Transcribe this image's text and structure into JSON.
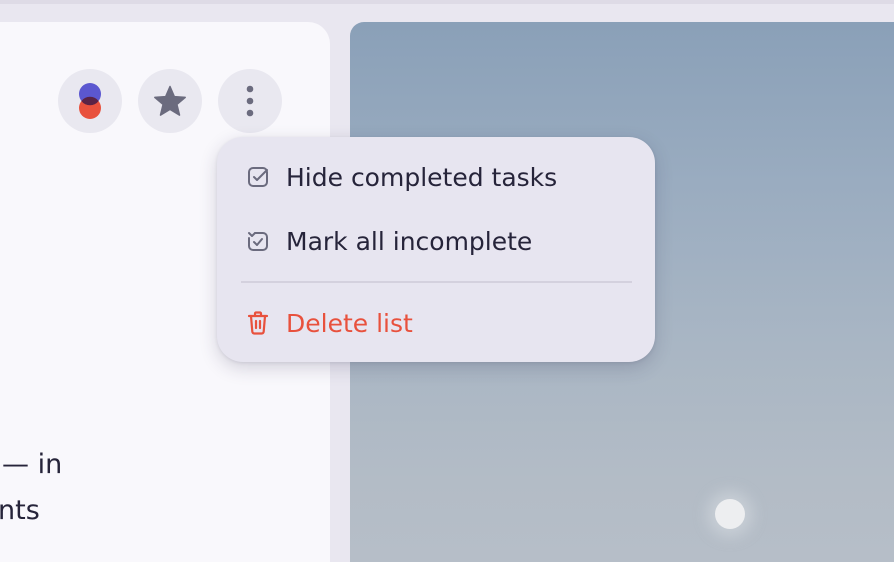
{
  "toolbar": {
    "buttons": [
      {
        "name": "color-theme",
        "icon": "color-circles-icon"
      },
      {
        "name": "favorite",
        "icon": "star-icon"
      },
      {
        "name": "more-options",
        "icon": "vertical-ellipsis-icon"
      }
    ]
  },
  "menu": {
    "items": [
      {
        "label": "Hide completed tasks",
        "icon": "checkbox-checked-icon"
      },
      {
        "label": "Mark all incomplete",
        "icon": "checkbox-undo-icon"
      },
      {
        "label": "Delete list",
        "icon": "trash-icon",
        "color": "#e8513d"
      }
    ]
  },
  "content": {
    "line1": "— in",
    "line2": "nts"
  },
  "colors": {
    "accent_blue": "#5b57d0",
    "accent_red": "#e8513d",
    "danger": "#e8513d"
  }
}
